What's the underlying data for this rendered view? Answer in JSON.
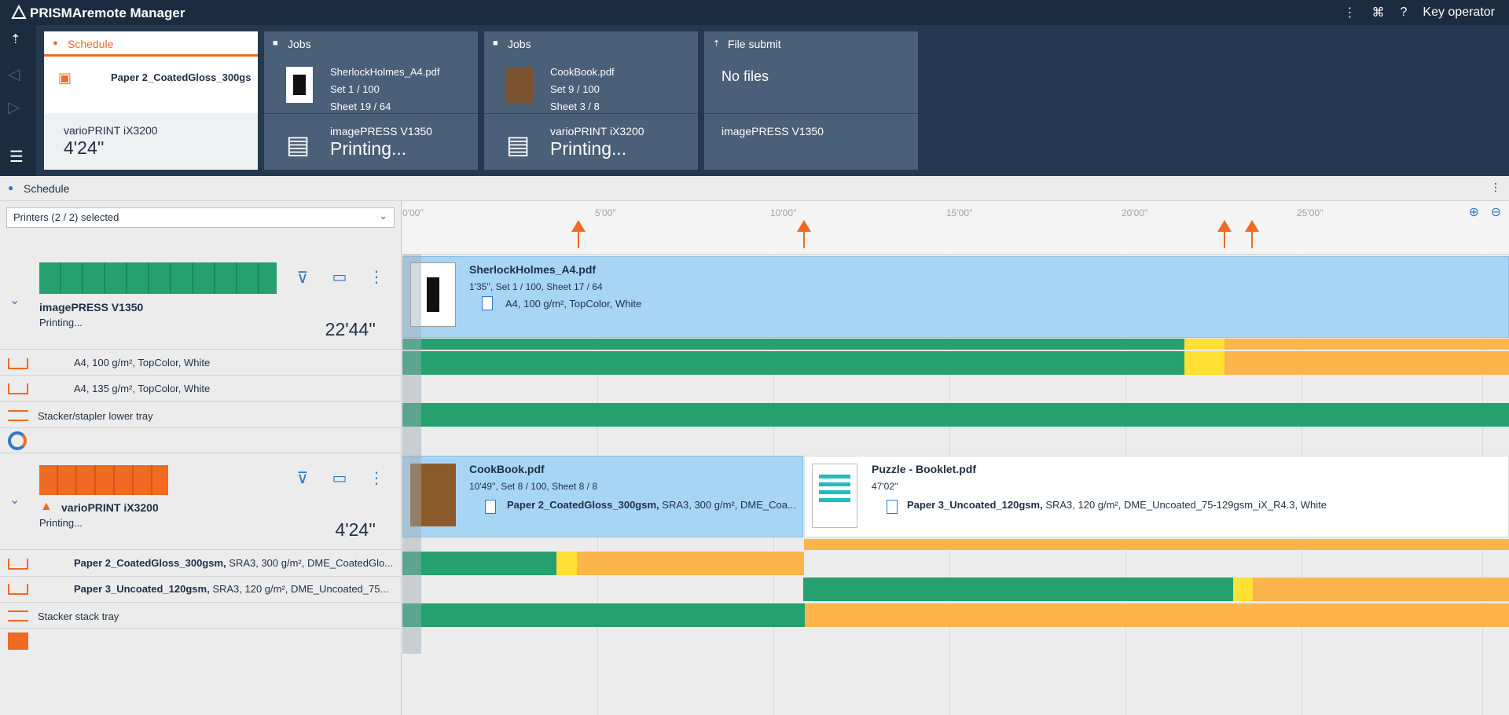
{
  "app": {
    "title": "PRISMAremote Manager",
    "user": "Key operator"
  },
  "dashboard": {
    "schedule": {
      "label": "Schedule",
      "media": "Paper 2_CoatedGloss_300gs",
      "printer": "varioPRINT iX3200",
      "time": "4'24''"
    },
    "jobs1": {
      "label": "Jobs",
      "file": "SherlockHolmes_A4.pdf",
      "set": "Set 1 / 100",
      "sheet": "Sheet 19 / 64",
      "printer": "imagePRESS V1350",
      "status": "Printing..."
    },
    "jobs2": {
      "label": "Jobs",
      "file": "CookBook.pdf",
      "set": "Set 9 / 100",
      "sheet": "Sheet 3 / 8",
      "printer": "varioPRINT iX3200",
      "status": "Printing..."
    },
    "submit": {
      "label": "File submit",
      "files": "No files",
      "printer": "imagePRESS V1350"
    }
  },
  "schedule": {
    "title": "Schedule",
    "filter": "Printers (2 / 2) selected",
    "ticks": [
      "0'00''",
      "5'00''",
      "10'00''",
      "15'00''",
      "20'00''",
      "25'00''"
    ]
  },
  "printers": [
    {
      "name": "imagePRESS V1350",
      "state": "Printing...",
      "time": "22'44''",
      "media": [
        "A4, 100 g/m², TopColor, White",
        "A4, 135 g/m², TopColor, White"
      ],
      "output": "Stacker/stapler lower tray",
      "job": {
        "title": "SherlockHolmes_A4.pdf",
        "sub": "1'35'', Set 1 / 100, Sheet 17 / 64",
        "media": "A4, 100 g/m², TopColor, White"
      }
    },
    {
      "name": "varioPRINT iX3200",
      "state": "Printing...",
      "time": "4'24''",
      "media": [
        {
          "name": "Paper 2_CoatedGloss_300gsm,",
          "detail": " SRA3, 300 g/m², DME_CoatedGlo..."
        },
        {
          "name": "Paper 3_Uncoated_120gsm,",
          "detail": " SRA3, 120 g/m², DME_Uncoated_75..."
        }
      ],
      "output": "Stacker stack tray",
      "job1": {
        "title": "CookBook.pdf",
        "sub": "10'49'', Set 8 / 100, Sheet 8 / 8",
        "media_name": "Paper 2_CoatedGloss_300gsm,",
        "media_detail": " SRA3, 300 g/m², DME_Coa..."
      },
      "job2": {
        "title": "Puzzle - Booklet.pdf",
        "sub": "47'02''",
        "media_name": "Paper 3_Uncoated_120gsm,",
        "media_detail": " SRA3, 120 g/m², DME_Uncoated_75-129gsm_iX_R4.3, White"
      }
    }
  ],
  "colors": {
    "accent": "#ef6a22",
    "ok": "#26a06f",
    "warn": "#ffe033",
    "low": "#fdb54b",
    "job": "#a9d5f5"
  }
}
